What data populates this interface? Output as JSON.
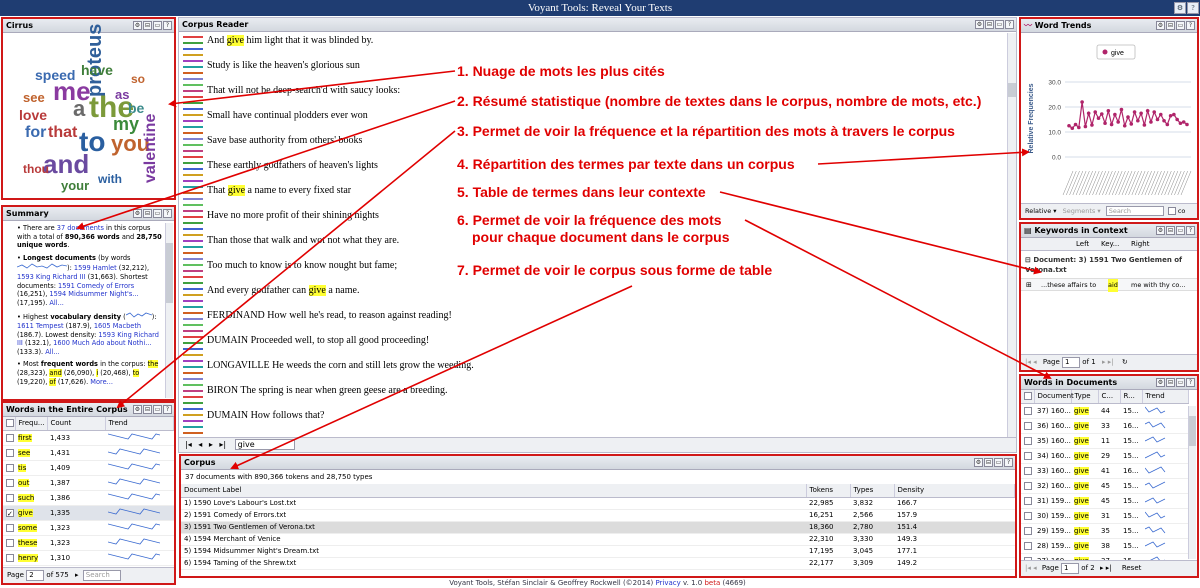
{
  "app": {
    "title": "Voyant Tools: Reveal Your Texts",
    "footer_a": "Voyant Tools, Stéfan Sinclair & Geoffrey Rockwell (©2014) ",
    "footer_privacy": "Privacy",
    "footer_b": " v. 1.0 ",
    "footer_beta": "beta",
    "footer_c": " (4669)"
  },
  "cirrus": {
    "title": "Cirrus",
    "words": [
      "speed",
      "me",
      "proteus",
      "have",
      "see",
      "love",
      "a",
      "the",
      "to",
      "as",
      "be",
      "for",
      "that",
      "and",
      "you",
      "my",
      "thou",
      "valentine",
      "your",
      "with",
      "so"
    ]
  },
  "summary": {
    "title": "Summary",
    "p1_a": "There are ",
    "p1_link": "37 documents",
    "p1_b": " in this corpus with a total of ",
    "p1_words": "890,366 words",
    "p1_c": " and ",
    "p1_unique": "28,750 unique words",
    "p1_d": ".",
    "p2_head": "Longest documents",
    "p2_a": " (by words ",
    "p2_l1": "1599 Hamlet",
    "p2_b": " (32,212), ",
    "p2_l2": "1593 King Richard III",
    "p2_c": " (31,663). Shortest documents: ",
    "p2_l3": "1591 Comedy of Errors",
    "p2_d": " (16,251), ",
    "p2_l4": "1594 Midsummer Night's...",
    "p2_e": " (17,195). ",
    "p2_all": "All...",
    "p3_a": "Highest ",
    "p3_head": "vocabulary density",
    "p3_b": " (",
    "p3_l1": "1611 Tempest",
    "p3_c": " (187.9), ",
    "p3_l2": "1605 Macbeth",
    "p3_d": " (186.7). Lowest density: ",
    "p3_l3": "1593 King Richard III",
    "p3_e": " (132.1), ",
    "p3_l4": "1600 Much Ado about Nothi...",
    "p3_f": " (133.3). ",
    "p3_all": "All...",
    "p4_a": "Most ",
    "p4_head": "frequent words",
    "p4_b": " in the corpus: ",
    "p4_w1": "the",
    "p4_c": " (28,323), ",
    "p4_w2": "and",
    "p4_d": " (26,090), ",
    "p4_w3": "i",
    "p4_e": " (20,468), ",
    "p4_w4": "to",
    "p4_f": " (19,220), ",
    "p4_w5": "of",
    "p4_g": " (17,626). ",
    "p4_more": "More..."
  },
  "words_corpus": {
    "title": "Words in the Entire Corpus",
    "col_freq": "Frequ...",
    "col_count": "Count",
    "col_trend": "Trend",
    "rows": [
      {
        "word": "first",
        "count": "1,433"
      },
      {
        "word": "see",
        "count": "1,431"
      },
      {
        "word": "tis",
        "count": "1,409"
      },
      {
        "word": "out",
        "count": "1,387"
      },
      {
        "word": "such",
        "count": "1,386"
      },
      {
        "word": "give",
        "count": "1,335",
        "checked": true
      },
      {
        "word": "some",
        "count": "1,323"
      },
      {
        "word": "these",
        "count": "1,323"
      },
      {
        "word": "henry",
        "count": "1,310"
      }
    ],
    "page_label": "Page",
    "page_value": "2",
    "page_of": "of 575",
    "search_placeholder": "Search"
  },
  "reader": {
    "title": "Corpus Reader",
    "lines": [
      {
        "pre": "And ",
        "hl": "give",
        "post": " him light that it was blinded by."
      },
      {
        "pre": "Study is like the heaven's glorious sun",
        "hl": "",
        "post": ""
      },
      {
        "pre": "That will not be deep-search'd with saucy looks:",
        "hl": "",
        "post": ""
      },
      {
        "pre": "Small have continual plodders ever won",
        "hl": "",
        "post": ""
      },
      {
        "pre": "Save base authority from others' books",
        "hl": "",
        "post": ""
      },
      {
        "pre": "These earthly godfathers of heaven's lights",
        "hl": "",
        "post": ""
      },
      {
        "pre": "That ",
        "hl": "give",
        "post": " a name to every fixed star"
      },
      {
        "pre": "Have no more profit of their shining nights",
        "hl": "",
        "post": ""
      },
      {
        "pre": "Than those that walk and wot not what they are.",
        "hl": "",
        "post": ""
      },
      {
        "pre": "Too much to know is to know nought but fame;",
        "hl": "",
        "post": ""
      },
      {
        "pre": "And every godfather can ",
        "hl": "give",
        "post": " a name."
      },
      {
        "pre": "FERDINAND How well he's read, to reason against reading!",
        "hl": "",
        "post": ""
      },
      {
        "pre": "DUMAIN Proceeded well, to stop all good proceeding!",
        "hl": "",
        "post": ""
      },
      {
        "pre": "LONGAVILLE He weeds the corn and still lets grow the weeding.",
        "hl": "",
        "post": ""
      },
      {
        "pre": "BIRON The spring is near when green geese are a breeding.",
        "hl": "",
        "post": ""
      },
      {
        "pre": "DUMAIN How follows that?",
        "hl": "",
        "post": ""
      }
    ],
    "search_value": "give"
  },
  "corpus": {
    "title": "Corpus",
    "subtitle": "37 documents with 890,366 tokens and 28,750 types",
    "col_label": "Document Label",
    "col_tokens": "Tokens",
    "col_types": "Types",
    "col_density": "Density",
    "rows": [
      {
        "label": "1) 1590 Love's Labour's Lost.txt",
        "tokens": "22,985",
        "types": "3,832",
        "density": "166.7"
      },
      {
        "label": "2) 1591 Comedy of Errors.txt",
        "tokens": "16,251",
        "types": "2,566",
        "density": "157.9"
      },
      {
        "label": "3) 1591 Two Gentlemen of Verona.txt",
        "tokens": "18,360",
        "types": "2,780",
        "density": "151.4",
        "selected": true
      },
      {
        "label": "4) 1594 Merchant of Venice",
        "tokens": "22,310",
        "types": "3,330",
        "density": "149.3"
      },
      {
        "label": "5) 1594 Midsummer Night's Dream.txt",
        "tokens": "17,195",
        "types": "3,045",
        "density": "177.1"
      },
      {
        "label": "6) 1594 Taming of the Shrew.txt",
        "tokens": "22,177",
        "types": "3,309",
        "density": "149.2"
      }
    ]
  },
  "trends": {
    "title": "Word Trends",
    "legend": "give",
    "ylabel": "Relative Frequencies",
    "btn_relative": "Relative",
    "btn_segments": "Segments",
    "search_placeholder": "Search",
    "cut_label": "co"
  },
  "chart_data": {
    "type": "line",
    "title": "",
    "xlabel": "",
    "ylabel": "Relative Frequencies",
    "ylim": [
      0,
      30
    ],
    "yticks": [
      "0.0",
      "10.0",
      "20.0",
      "30.0"
    ],
    "series": [
      {
        "name": "give",
        "color": "#b0246a",
        "values": [
          12.5,
          11.5,
          13.0,
          11.8,
          22.0,
          12.2,
          17.5,
          12.8,
          18.0,
          15.5,
          17.2,
          13.5,
          18.5,
          13.0,
          17.0,
          14.0,
          19.0,
          12.5,
          16.0,
          13.2,
          18.0,
          14.5,
          17.5,
          12.8,
          18.5,
          14.0,
          18.0,
          15.0,
          17.0,
          14.5,
          13.0,
          16.5,
          17.0,
          15.0,
          13.5,
          14.0,
          13.0
        ]
      }
    ]
  },
  "kwic": {
    "title": "Keywords in Context",
    "col_left": "Left",
    "col_key": "Key...",
    "col_right": "Right",
    "group": "Document: 3) 1591 Two Gentlemen of Verona.txt",
    "row_left": "...these affairs to",
    "row_key": "aid",
    "row_right": "me with thy co...",
    "page_label": "Page",
    "page_value": "1",
    "page_of": "of 1"
  },
  "docs": {
    "title": "Words in Documents",
    "col_doc": "Document",
    "col_type": "Type",
    "col_c": "C...",
    "col_r": "R...",
    "col_trend": "Trend",
    "rows": [
      {
        "doc": "37) 160...",
        "type": "give",
        "c": "44",
        "r": "15..."
      },
      {
        "doc": "36) 160...",
        "type": "give",
        "c": "33",
        "r": "16..."
      },
      {
        "doc": "35) 160...",
        "type": "give",
        "c": "11",
        "r": "15..."
      },
      {
        "doc": "34) 160...",
        "type": "give",
        "c": "29",
        "r": "15..."
      },
      {
        "doc": "33) 160...",
        "type": "give",
        "c": "41",
        "r": "16..."
      },
      {
        "doc": "32) 160...",
        "type": "give",
        "c": "45",
        "r": "15..."
      },
      {
        "doc": "31) 159...",
        "type": "give",
        "c": "45",
        "r": "15..."
      },
      {
        "doc": "30) 159...",
        "type": "give",
        "c": "31",
        "r": "15..."
      },
      {
        "doc": "29) 159...",
        "type": "give",
        "c": "35",
        "r": "15..."
      },
      {
        "doc": "28) 159...",
        "type": "give",
        "c": "38",
        "r": "15..."
      },
      {
        "doc": "27) 160...",
        "type": "give",
        "c": "37",
        "r": "15..."
      }
    ],
    "page_label": "Page",
    "page_value": "1",
    "page_of": "of 2",
    "reset": "Reset"
  },
  "annotations": [
    "1. Nuage de mots les plus cités",
    "2. Résumé statistique (nombre de textes dans le corpus, nombre de mots, etc.)",
    "3. Permet de voir la fréquence et la répartition des mots à travers le corpus",
    "4. Répartition des termes par texte dans un corpus",
    "5. Table de termes dans leur contexte",
    "6. Permet de voir la fréquence des mots",
    "pour chaque document dans le corpus",
    "7. Permet de voir le corpus sous forme de table"
  ]
}
